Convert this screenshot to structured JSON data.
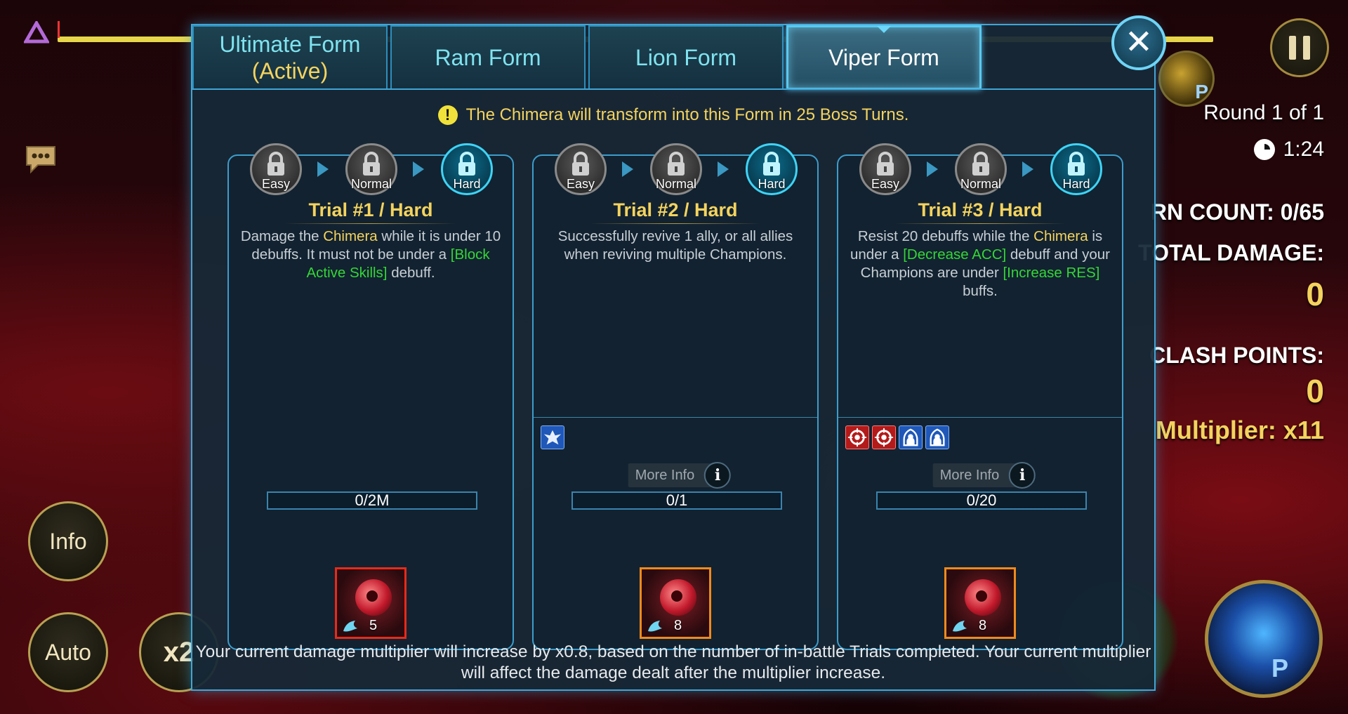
{
  "hud": {
    "round": "Round 1 of 1",
    "timer": "1:24",
    "turn_count": "RN COUNT: 0/65",
    "total_damage_label": "TOTAL DAMAGE:",
    "total_damage_value": "0",
    "clash_points_label": "CLASH POINTS:",
    "clash_points_value": "0",
    "multiplier": "Multiplier: x11",
    "info_button": "Info",
    "auto_button": "Auto",
    "speed_button": "x2",
    "portrait_badge": "P"
  },
  "modal": {
    "tabs": [
      {
        "label": "Ultimate Form",
        "sub": "(Active)"
      },
      {
        "label": "Ram Form"
      },
      {
        "label": "Lion Form"
      },
      {
        "label": "Viper Form",
        "selected": true
      }
    ],
    "close_label": "✕",
    "notice": "The Chimera will transform into this Form in 25 Boss Turns.",
    "difficulties": [
      "Easy",
      "Normal",
      "Hard"
    ],
    "more_info": "More Info",
    "trials": [
      {
        "title": "Trial #1 / Hard",
        "desc": [
          {
            "t": "Damage the "
          },
          {
            "t": "Chimera",
            "c": "y"
          },
          {
            "t": " while it is under 10 debuffs. It must not be under a "
          },
          {
            "t": "[Block Active Skills]",
            "c": "g"
          },
          {
            "t": " debuff."
          }
        ],
        "progress": "0/2M",
        "reward_count": "5",
        "reward_border": "red",
        "effects": []
      },
      {
        "title": "Trial #2 / Hard",
        "desc": [
          {
            "t": "Successfully revive 1 ally, or all allies when reviving multiple Champions."
          }
        ],
        "progress": "0/1",
        "reward_count": "8",
        "reward_border": "orange",
        "effects": [
          "revive-icon"
        ]
      },
      {
        "title": "Trial #3 / Hard",
        "desc": [
          {
            "t": "Resist 20 debuffs while the "
          },
          {
            "t": "Chimera",
            "c": "y"
          },
          {
            "t": " is under a "
          },
          {
            "t": "[Decrease ACC]",
            "c": "g"
          },
          {
            "t": " debuff and your Champions are under "
          },
          {
            "t": "[Increase RES]",
            "c": "g"
          },
          {
            "t": " buffs."
          }
        ],
        "progress": "0/20",
        "reward_count": "8",
        "reward_border": "orange",
        "effects": [
          "decrease-acc-icon",
          "decrease-acc-icon",
          "increase-res-icon",
          "increase-res-icon"
        ]
      }
    ],
    "footer": "Your current damage multiplier will increase by x0.8, based on the number of in-battle Trials completed. Your current multiplier will affect the damage dealt after the multiplier increase."
  },
  "colors": {
    "accent": "#3fa6d6",
    "gold": "#f4d35e",
    "green": "#34d637"
  }
}
